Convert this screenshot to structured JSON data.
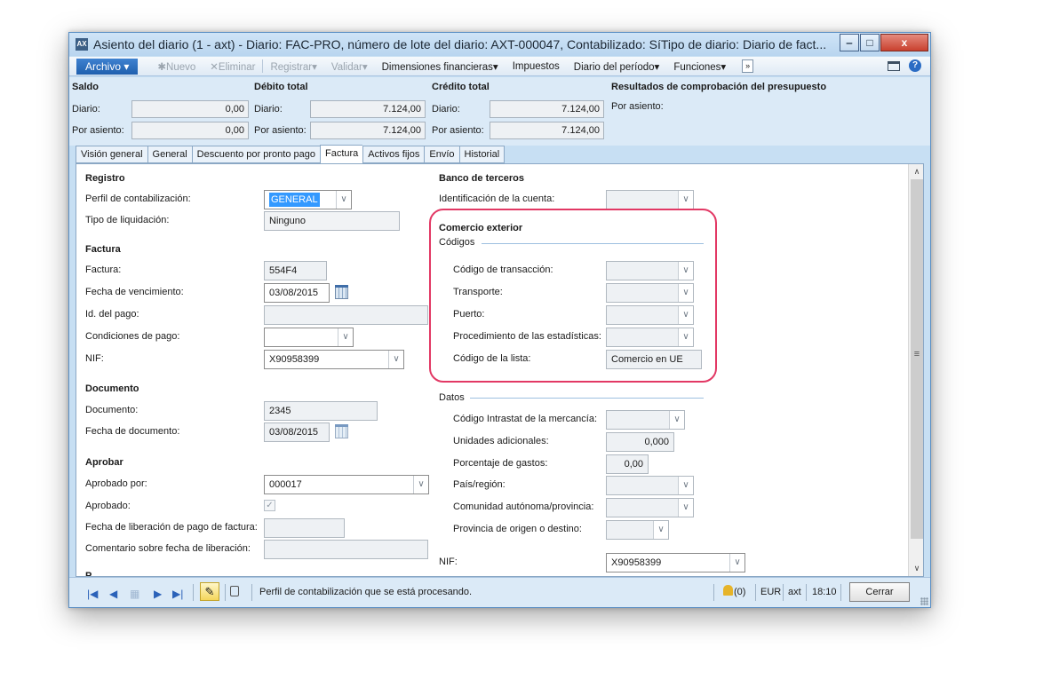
{
  "window": {
    "title": "Asiento del diario (1 - axt) - Diario: FAC-PRO, número de lote del diario: AXT-000047, Contabilizado: SíTipo de diario: Diario de fact...",
    "app_icon": "AX"
  },
  "menubar": {
    "archivo": "Archivo",
    "items": [
      {
        "label": "Nuevo",
        "disabled": true
      },
      {
        "label": "Eliminar",
        "disabled": true
      },
      {
        "label": "Registrar",
        "disabled": true
      },
      {
        "label": "Validar",
        "disabled": true
      },
      {
        "label": "Dimensiones financieras",
        "disabled": false
      },
      {
        "label": "Impuestos",
        "disabled": false
      },
      {
        "label": "Diario del período",
        "disabled": false
      },
      {
        "label": "Funciones",
        "disabled": false
      }
    ],
    "more": "»"
  },
  "summary": {
    "saldo": {
      "title": "Saldo",
      "diario_label": "Diario:",
      "diario": "0,00",
      "asiento_label": "Por asiento:",
      "asiento": "0,00"
    },
    "debito": {
      "title": "Débito total",
      "diario_label": "Diario:",
      "diario": "7.124,00",
      "asiento_label": "Por asiento:",
      "asiento": "7.124,00"
    },
    "credito": {
      "title": "Crédito total",
      "diario_label": "Diario:",
      "diario": "7.124,00",
      "asiento_label": "Por asiento:",
      "asiento": "7.124,00"
    },
    "presupuesto": {
      "title": "Resultados de comprobación del presupuesto",
      "asiento_label": "Por asiento:"
    }
  },
  "tabs": [
    "Visión general",
    "General",
    "Descuento por pronto pago",
    "Factura",
    "Activos fijos",
    "Envío",
    "Historial"
  ],
  "left": {
    "registro": {
      "title": "Registro",
      "perfil_label": "Perfil de contabilización:",
      "perfil": "GENERAL",
      "tipo_label": "Tipo de liquidación:",
      "tipo": "Ninguno"
    },
    "factura": {
      "title": "Factura",
      "factura_label": "Factura:",
      "factura": "554F4",
      "vencimiento_label": "Fecha de vencimiento:",
      "vencimiento": "03/08/2015",
      "pago_label": "Id. del pago:",
      "pago": "",
      "condiciones_label": "Condiciones de pago:",
      "condiciones": "",
      "nif_label": "NIF:",
      "nif": "X90958399"
    },
    "documento": {
      "title": "Documento",
      "documento_label": "Documento:",
      "documento": "2345",
      "fecha_label": "Fecha de documento:",
      "fecha": "03/08/2015"
    },
    "aprobar": {
      "title": "Aprobar",
      "aprobado_por_label": "Aprobado por:",
      "aprobado_por": "000017",
      "aprobado_label": "Aprobado:",
      "aprobado_check": "✓",
      "liberacion_label": "Fecha de liberación de pago de factura:",
      "liberacion": "",
      "comentario_label": "Comentario sobre fecha de liberación:",
      "comentario": ""
    },
    "cut_heading": "P"
  },
  "right": {
    "banco": {
      "title": "Banco de terceros",
      "cuenta_label": "Identificación de la cuenta:",
      "cuenta": ""
    },
    "comercio": {
      "title": "Comercio exterior",
      "codigos_title": "Códigos",
      "transaccion_label": "Código de transacción:",
      "transaccion": "",
      "transporte_label": "Transporte:",
      "transporte": "",
      "puerto_label": "Puerto:",
      "puerto": "",
      "procedimiento_label": "Procedimiento de las estadísticas:",
      "procedimiento": "",
      "lista_label": "Código de la lista:",
      "lista": "Comercio en UE"
    },
    "datos": {
      "title": "Datos",
      "intrastat_label": "Código Intrastat de la mercancía:",
      "intrastat": "",
      "unidades_label": "Unidades adicionales:",
      "unidades": "0,000",
      "gastos_label": "Porcentaje de gastos:",
      "gastos": "0,00",
      "pais_label": "País/región:",
      "pais": "",
      "comunidad_label": "Comunidad autónoma/provincia:",
      "comunidad": "",
      "provincia_label": "Provincia de origen o destino:",
      "provincia": ""
    },
    "nif_label": "NIF:",
    "nif": "X90958399"
  },
  "statusbar": {
    "message": "Perfil de contabilización que se está procesando.",
    "alerts": "(0)",
    "currency": "EUR",
    "company": "axt",
    "time": "18:10",
    "close": "Cerrar"
  },
  "colors": {
    "accent": "#1f5fae",
    "highlight": "#e23864",
    "selection": "#3399ff"
  }
}
